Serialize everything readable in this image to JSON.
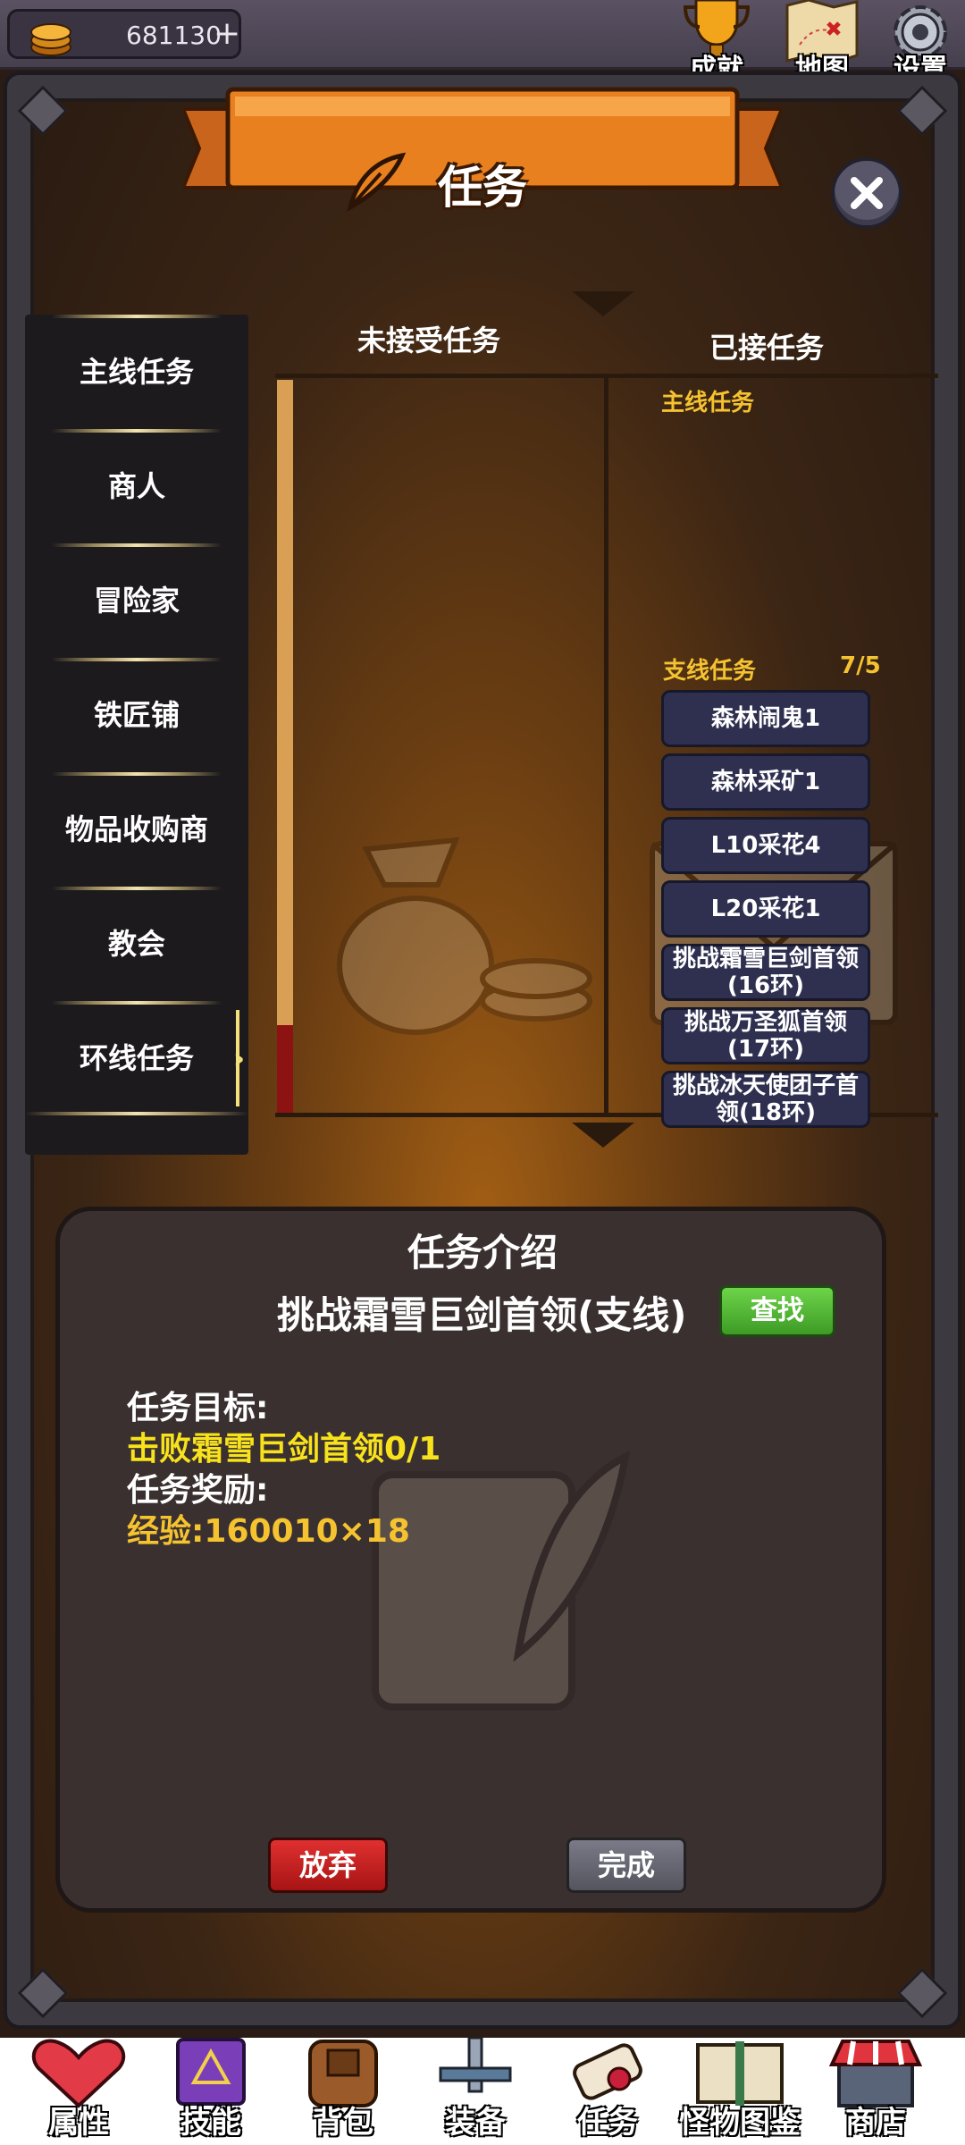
{
  "topbar": {
    "gold_amount": "681130",
    "plus_label": "+",
    "icons": [
      {
        "label": "成就",
        "icon": "trophy-icon"
      },
      {
        "label": "地图",
        "icon": "map-icon"
      },
      {
        "label": "设置",
        "icon": "gear-icon"
      }
    ]
  },
  "panel": {
    "title": "任务",
    "close_label": "✕"
  },
  "sidebar": {
    "items": [
      {
        "label": "主线任务"
      },
      {
        "label": "商人"
      },
      {
        "label": "冒险家"
      },
      {
        "label": "铁匠铺"
      },
      {
        "label": "物品收购商"
      },
      {
        "label": "教会"
      },
      {
        "label": "环线任务",
        "selected": true
      }
    ],
    "selected_arrow": "›"
  },
  "lists": {
    "unaccepted_header": "未接受任务",
    "accepted_header": "已接任务",
    "main_label": "主线任务",
    "branch_label": "支线任务",
    "branch_count": "7/5",
    "accepted_quests": [
      "森林闹鬼1",
      "森林采矿1",
      "L10采花4",
      "L20采花1",
      "挑战霜雪巨剑首领(16环)",
      "挑战万圣狐首领(17环)",
      "挑战冰天使团子首领(18环)"
    ],
    "scroll_progress": 0.12
  },
  "detail": {
    "title": "任务介绍",
    "quest_name": "挑战霜雪巨剑首领(支线)",
    "find_label": "查找",
    "goal_label": "任务目标:",
    "goal_value": "击败霜雪巨剑首领0/1",
    "reward_label": "任务奖励:",
    "reward_value": "经验:160010×18",
    "abandon_label": "放弃",
    "complete_label": "完成"
  },
  "bottom_nav": {
    "items": [
      {
        "label": "属性",
        "icon": "heart-icon"
      },
      {
        "label": "技能",
        "icon": "spellbook-icon"
      },
      {
        "label": "背包",
        "icon": "backpack-icon"
      },
      {
        "label": "装备",
        "icon": "sword-icon"
      },
      {
        "label": "任务",
        "icon": "scroll-icon"
      },
      {
        "label": "怪物图鉴",
        "icon": "book-icon"
      },
      {
        "label": "商店",
        "icon": "shop-icon"
      }
    ]
  },
  "colors": {
    "accent_yellow": "#f5c330",
    "goal_yellow": "#f7e21c",
    "abandon_red": "#c82020",
    "find_green": "#4fb534",
    "quest_button": "#2f3050"
  }
}
